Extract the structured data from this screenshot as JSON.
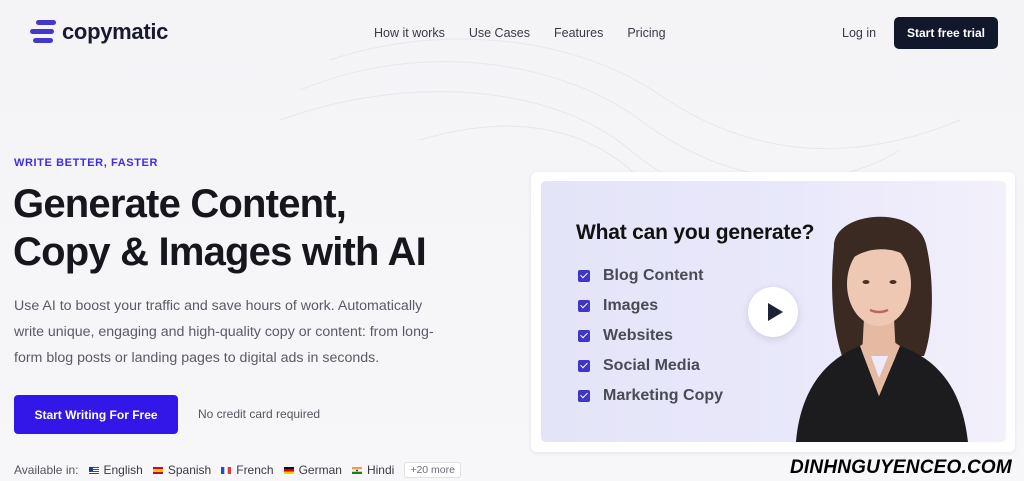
{
  "brand": {
    "name": "copymatic",
    "accent": "#3317e8",
    "logo_color": "#4338ca"
  },
  "nav": {
    "links": [
      "How it works",
      "Use Cases",
      "Features",
      "Pricing"
    ],
    "login": "Log in",
    "trial": "Start free trial"
  },
  "hero": {
    "eyebrow": "WRITE BETTER, FASTER",
    "headline_line1": "Generate Content,",
    "headline_line2": "Copy & Images with AI",
    "description": "Use AI to boost your traffic and save hours of work. Automatically write unique, engaging and high-quality copy or content: from long-form blog posts or landing pages to digital ads in seconds.",
    "cta": "Start Writing For Free",
    "cta_note": "No credit card required"
  },
  "languages": {
    "label": "Available in:",
    "items": [
      {
        "name": "English",
        "flag": "us-flag-icon"
      },
      {
        "name": "Spanish",
        "flag": "es-flag-icon"
      },
      {
        "name": "French",
        "flag": "fr-flag-icon"
      },
      {
        "name": "German",
        "flag": "de-flag-icon"
      },
      {
        "name": "Hindi",
        "flag": "in-flag-icon"
      }
    ],
    "more": "+20 more"
  },
  "video": {
    "title": "What can you generate?",
    "items": [
      "Blog Content",
      "Images",
      "Websites",
      "Social Media",
      "Marketing Copy"
    ],
    "play_icon": "play-icon"
  },
  "watermark": "DINHNGUYENCEO.COM"
}
